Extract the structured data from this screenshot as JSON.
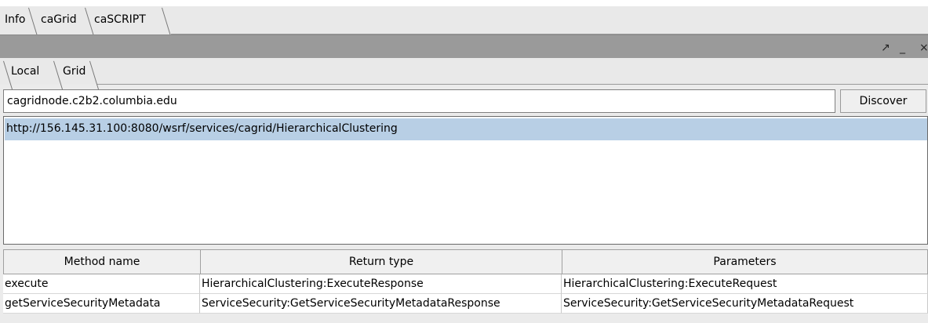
{
  "outer_tabs": [
    {
      "label": "Info"
    },
    {
      "label": "caGrid"
    },
    {
      "label": "caSCRIPT"
    }
  ],
  "titlebar": {
    "maximize_icon": "↗",
    "minimize_icon": "_",
    "close_icon": "×"
  },
  "inner_tabs": [
    {
      "label": "Local"
    },
    {
      "label": "Grid"
    }
  ],
  "discovery": {
    "host_value": "cagridnode.c2b2.columbia.edu",
    "discover_label": "Discover"
  },
  "services": [
    {
      "url": "http://156.145.31.100:8080/wsrf/services/cagrid/HierarchicalClustering"
    }
  ],
  "methods": {
    "headers": [
      "Method name",
      "Return type",
      "Parameters"
    ],
    "rows": [
      [
        "execute",
        "HierarchicalClustering:ExecuteResponse",
        "HierarchicalClustering:ExecuteRequest"
      ],
      [
        "getServiceSecurityMetadata",
        "ServiceSecurity:GetServiceSecurityMetadataResponse",
        "ServiceSecurity:GetServiceSecurityMetadataRequest"
      ]
    ]
  }
}
